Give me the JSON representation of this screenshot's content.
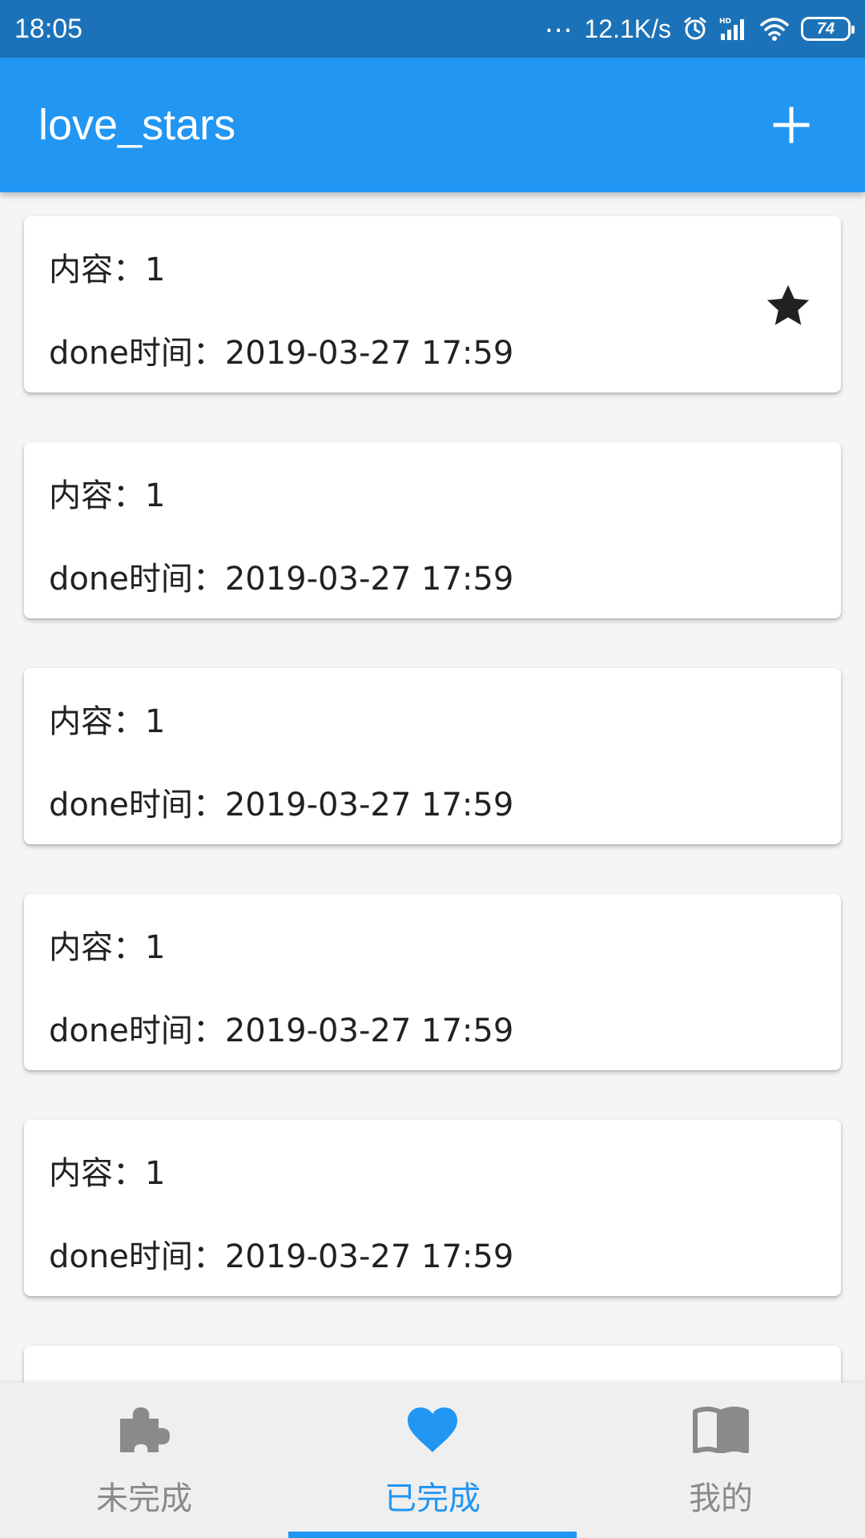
{
  "status_bar": {
    "time": "18:05",
    "dots": "...",
    "speed": "12.1K/s",
    "battery": "74",
    "icons": [
      "alarm-icon",
      "signal-hd-icon",
      "wifi-icon",
      "battery-icon"
    ]
  },
  "app_bar": {
    "title": "love_stars",
    "add_icon": "plus-icon"
  },
  "colors": {
    "primary": "#2196f3",
    "status_bar": "#1c72b8",
    "inactive": "#8a8a8a"
  },
  "cards": [
    {
      "content": "内容：1",
      "time": "done时间：2019-03-27 17:59",
      "starred": true
    },
    {
      "content": "内容：1",
      "time": "done时间：2019-03-27 17:59",
      "starred": false
    },
    {
      "content": "内容：1",
      "time": "done时间：2019-03-27 17:59",
      "starred": false
    },
    {
      "content": "内容：1",
      "time": "done时间：2019-03-27 17:59",
      "starred": false
    },
    {
      "content": "内容：1",
      "time": "done时间：2019-03-27 17:59",
      "starred": false
    },
    {
      "content": "",
      "time": "",
      "starred": false
    }
  ],
  "bottom_nav": {
    "items": [
      {
        "label": "未完成",
        "icon": "puzzle-icon",
        "active": false
      },
      {
        "label": "已完成",
        "icon": "heart-icon",
        "active": true
      },
      {
        "label": "我的",
        "icon": "book-icon",
        "active": false
      }
    ]
  }
}
